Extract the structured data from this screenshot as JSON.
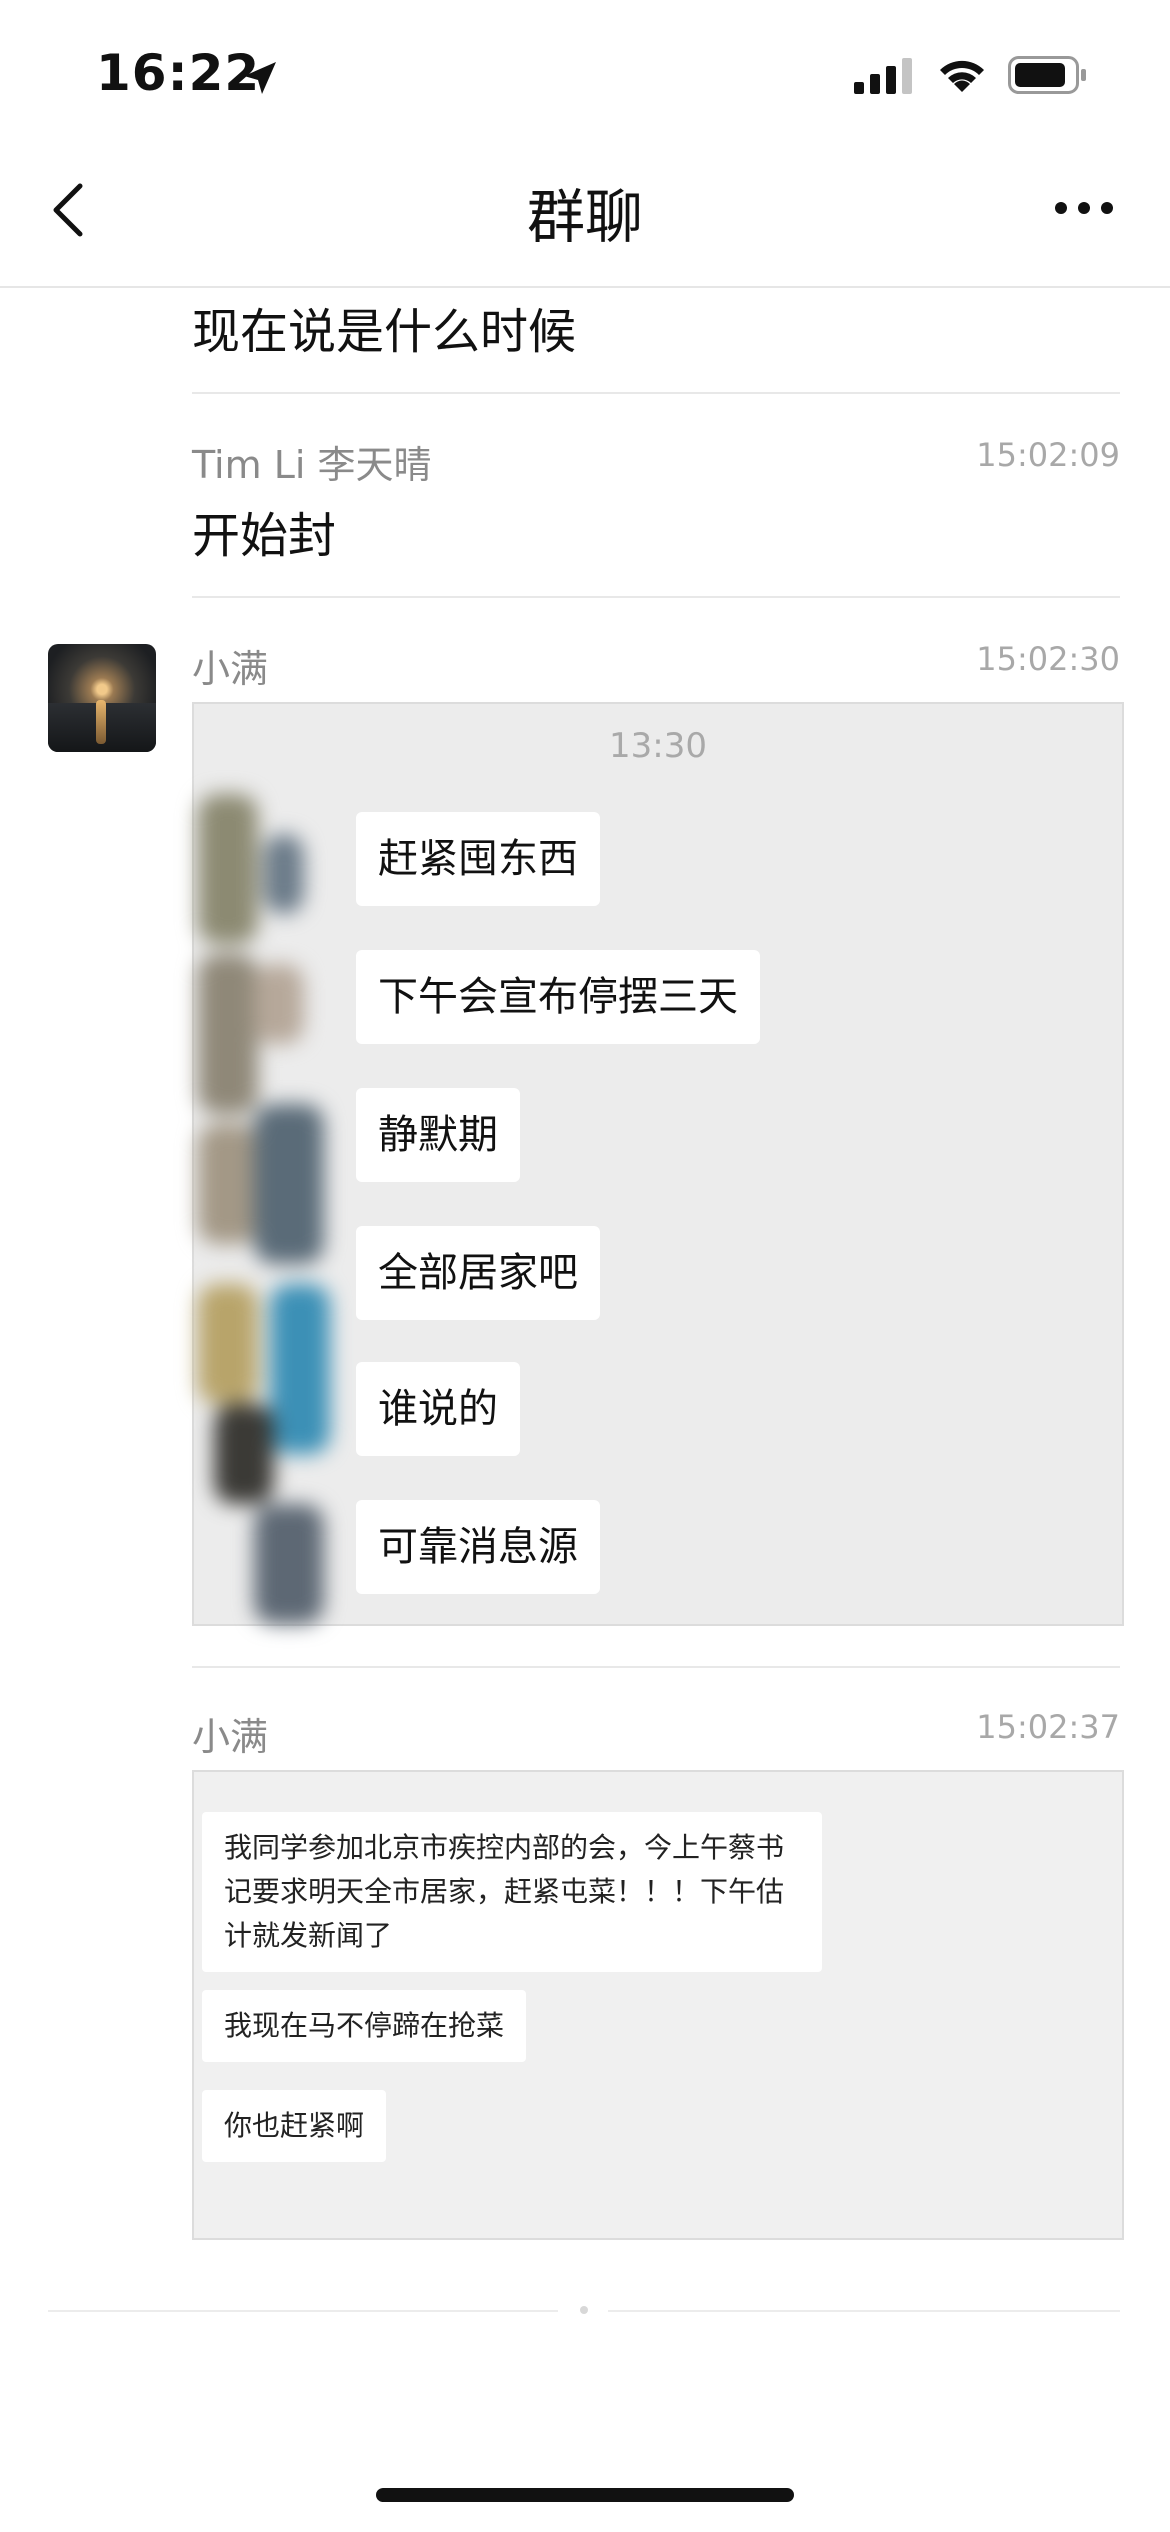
{
  "status_bar": {
    "time": "16:22"
  },
  "nav": {
    "title": "群聊"
  },
  "messages": [
    {
      "text": "现在说是什么时候"
    },
    {
      "sender": "Tim Li 李天晴",
      "timestamp": "15:02:09",
      "text": "开始封"
    },
    {
      "sender": "小满",
      "timestamp": "15:02:30",
      "screenshot_time": "13:30",
      "bubbles": [
        "赶紧囤东西",
        "下午会宣布停摆三天",
        "静默期",
        "全部居家吧",
        "谁说的",
        "可靠消息源"
      ]
    },
    {
      "sender": "小满",
      "timestamp": "15:02:37",
      "bubbles": [
        "我同学参加北京市疾控内部的会，今上午蔡书记要求明天全市居家，赶紧屯菜！！！下午估计就发新闻了",
        "我现在马不停蹄在抢菜",
        "你也赶紧啊"
      ]
    }
  ]
}
